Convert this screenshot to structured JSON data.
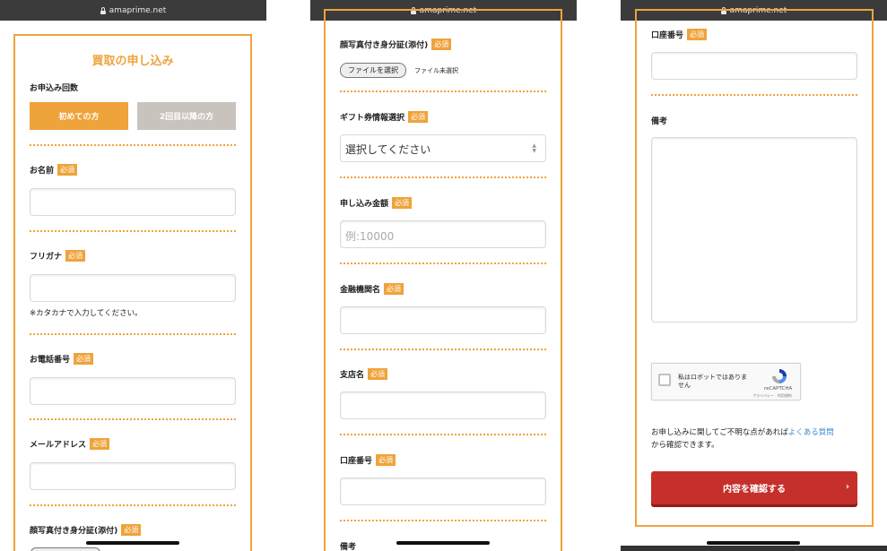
{
  "url": "amaprime.net",
  "colors": {
    "accent": "#efa33b",
    "submit": "#c5302a",
    "link": "#3b8bd6"
  },
  "required_label": "必須",
  "screen1": {
    "page_title": "買取の申し込み",
    "apply_count_label": "お申込み回数",
    "first_time_button": "初めての方",
    "repeat_button": "2回目以降の方",
    "name_label": "お名前",
    "furigana_label": "フリガナ",
    "furigana_note": "※カタカナで入力してください。",
    "phone_label": "お電話番号",
    "email_label": "メールアドレス",
    "id_photo_label": "顔写真付き身分証(添付)"
  },
  "screen2": {
    "id_photo_label": "顔写真付き身分証(添付)",
    "file_button": "ファイルを選択",
    "file_status": "ファイル未選択",
    "gift_label": "ギフト券情報選択",
    "gift_select_value": "選択してください",
    "amount_label": "申し込み金額",
    "amount_placeholder": "例:10000",
    "bank_label": "金融機関名",
    "branch_label": "支店名",
    "account_label": "口座番号",
    "remarks_label": "備考"
  },
  "screen3": {
    "account_label": "口座番号",
    "remarks_label": "備考",
    "captcha_text": "私はロボットではありません",
    "captcha_brand": "reCAPTCHA",
    "captcha_footer": "プライバシー - 利用規約",
    "help_text_before": "お申し込みに関してご不明な点があれば",
    "help_link": "よくある質問",
    "help_text_after": "から確認できます。",
    "submit_button": "内容を確認する",
    "submit_chevron": "›"
  }
}
